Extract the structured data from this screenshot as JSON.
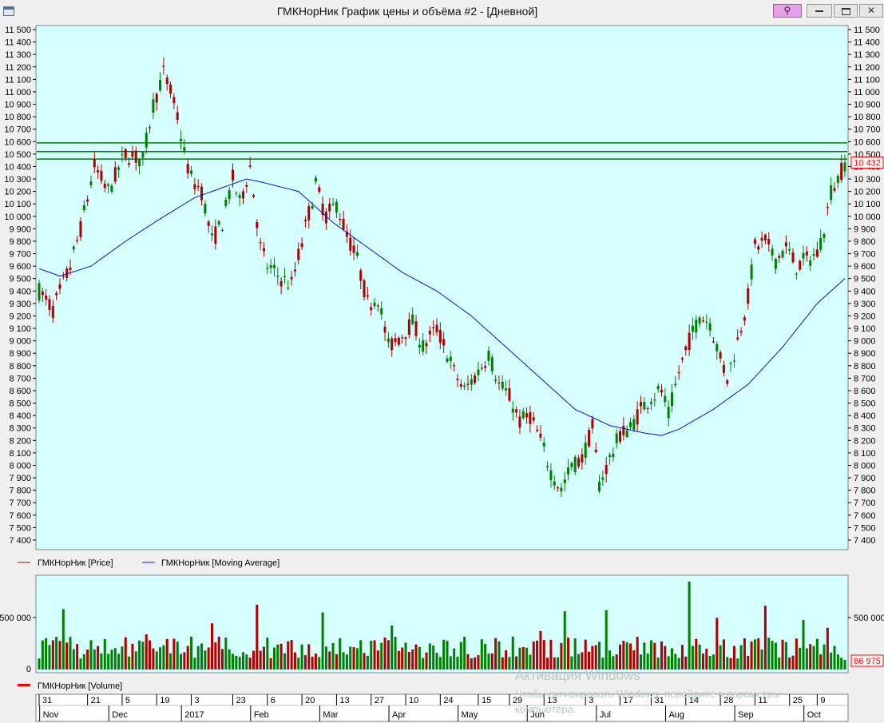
{
  "window": {
    "title": "ГМКНорНик График цены и объёма #2 - [Дневной]",
    "icons": [
      "window-icon",
      "pin-icon",
      "minimize-icon",
      "restore-icon",
      "close-icon"
    ]
  },
  "watermark": {
    "title": "Активация Windows",
    "line1": "Чтобы активировать Windows, перейдите в параметры",
    "line2": "компьютера."
  },
  "colors": {
    "panel_background": "#d6ffff",
    "up_candle": "#008000",
    "down_candle": "#b00000",
    "moving_average": "#1010c8",
    "resistance_lines": "#008000",
    "last_price": "#ff0000"
  },
  "chart_data": [
    {
      "type": "candlestick",
      "ylim": [
        7400,
        11500
      ],
      "y_ticks": [
        7400,
        7500,
        7600,
        7700,
        7800,
        7900,
        8000,
        8100,
        8200,
        8300,
        8400,
        8500,
        8600,
        8700,
        8800,
        8900,
        9000,
        9100,
        9200,
        9300,
        9400,
        9500,
        9600,
        9700,
        9800,
        9900,
        10000,
        10100,
        10200,
        10300,
        10400,
        10500,
        10600,
        10700,
        10800,
        10900,
        11000,
        11100,
        11200,
        11300,
        11400,
        11500
      ],
      "y_tick_labels": [
        "7 400",
        "7 500",
        "7 600",
        "7 700",
        "7 800",
        "7 900",
        "8 000",
        "8 100",
        "8 200",
        "8 300",
        "8 400",
        "8 500",
        "8 600",
        "8 700",
        "8 800",
        "8 900",
        "9 000",
        "9 100",
        "9 200",
        "9 300",
        "9 400",
        "9 500",
        "9 600",
        "9 700",
        "9 800",
        "9 900",
        "10 000",
        "10 100",
        "10 200",
        "10 300",
        "10 400",
        "10 500",
        "10 600",
        "10 700",
        "10 800",
        "10 900",
        "11 000",
        "11 100",
        "11 200",
        "11 300",
        "11 400",
        "11 500"
      ],
      "horizontal_levels": [
        10460,
        10520,
        10590
      ],
      "last_price": 10432,
      "last_price_label": "10 432",
      "price_path": [
        [
          0,
          9400
        ],
        [
          4,
          9250
        ],
        [
          9,
          9600
        ],
        [
          12,
          9900
        ],
        [
          16,
          10400
        ],
        [
          20,
          10200
        ],
        [
          25,
          10500
        ],
        [
          30,
          10450
        ],
        [
          33,
          10900
        ],
        [
          36,
          11150
        ],
        [
          38,
          11000
        ],
        [
          40,
          10800
        ],
        [
          42,
          10500
        ],
        [
          44,
          10300
        ],
        [
          47,
          10200
        ],
        [
          50,
          9800
        ],
        [
          53,
          9950
        ],
        [
          56,
          10300
        ],
        [
          58,
          10100
        ],
        [
          61,
          10400
        ],
        [
          64,
          9750
        ],
        [
          66,
          9600
        ],
        [
          70,
          9500
        ],
        [
          73,
          9450
        ],
        [
          76,
          9800
        ],
        [
          80,
          10250
        ],
        [
          83,
          10000
        ],
        [
          86,
          10100
        ],
        [
          89,
          9850
        ],
        [
          92,
          9650
        ],
        [
          95,
          9300
        ],
        [
          98,
          9350
        ],
        [
          101,
          8950
        ],
        [
          105,
          9050
        ],
        [
          108,
          9150
        ],
        [
          111,
          8950
        ],
        [
          115,
          9100
        ],
        [
          118,
          8900
        ],
        [
          120,
          8750
        ],
        [
          123,
          8600
        ],
        [
          127,
          8750
        ],
        [
          130,
          8900
        ],
        [
          133,
          8650
        ],
        [
          136,
          8550
        ],
        [
          139,
          8350
        ],
        [
          142,
          8400
        ],
        [
          145,
          8200
        ],
        [
          148,
          7950
        ],
        [
          151,
          7800
        ],
        [
          154,
          8000
        ],
        [
          157,
          8050
        ],
        [
          160,
          8300
        ],
        [
          162,
          7850
        ],
        [
          165,
          8050
        ],
        [
          168,
          8250
        ],
        [
          171,
          8300
        ],
        [
          174,
          8450
        ],
        [
          177,
          8550
        ],
        [
          180,
          8600
        ],
        [
          182,
          8400
        ],
        [
          185,
          8750
        ],
        [
          188,
          9000
        ],
        [
          191,
          9200
        ],
        [
          194,
          9150
        ],
        [
          197,
          8850
        ],
        [
          199,
          8700
        ],
        [
          202,
          9000
        ],
        [
          205,
          9350
        ],
        [
          207,
          9750
        ],
        [
          210,
          9800
        ],
        [
          213,
          9650
        ],
        [
          216,
          9750
        ],
        [
          219,
          9600
        ],
        [
          222,
          9650
        ],
        [
          225,
          9700
        ],
        [
          227,
          9900
        ],
        [
          229,
          10200
        ],
        [
          231,
          10300
        ],
        [
          233,
          10432
        ]
      ],
      "ma_path": [
        [
          0,
          9580
        ],
        [
          6,
          9520
        ],
        [
          15,
          9600
        ],
        [
          25,
          9800
        ],
        [
          35,
          9980
        ],
        [
          45,
          10150
        ],
        [
          55,
          10250
        ],
        [
          60,
          10300
        ],
        [
          65,
          10270
        ],
        [
          75,
          10200
        ],
        [
          85,
          9950
        ],
        [
          95,
          9750
        ],
        [
          105,
          9550
        ],
        [
          115,
          9400
        ],
        [
          125,
          9200
        ],
        [
          135,
          8950
        ],
        [
          145,
          8700
        ],
        [
          155,
          8450
        ],
        [
          165,
          8320
        ],
        [
          175,
          8260
        ],
        [
          180,
          8240
        ],
        [
          185,
          8290
        ],
        [
          195,
          8450
        ],
        [
          205,
          8650
        ],
        [
          215,
          8950
        ],
        [
          225,
          9300
        ],
        [
          233,
          9500
        ]
      ]
    },
    {
      "type": "bar",
      "series": [
        {
          "name": "ГМКНорНик [Volume]"
        }
      ],
      "y_tick_label": "500 000",
      "last_volume_label": "86 975",
      "volume_max": 800000,
      "spikes": [
        [
          7,
          550000
        ],
        [
          31,
          320000
        ],
        [
          50,
          420000
        ],
        [
          63,
          590000
        ],
        [
          82,
          520000
        ],
        [
          102,
          400000
        ],
        [
          145,
          350000
        ],
        [
          152,
          530000
        ],
        [
          164,
          540000
        ],
        [
          188,
          800000
        ],
        [
          196,
          470000
        ],
        [
          210,
          580000
        ],
        [
          221,
          450000
        ],
        [
          228,
          380000
        ]
      ]
    }
  ],
  "legend": {
    "price": "ГМКНорНик [Price]",
    "moving_average": "ГМКНорНик [Moving Average]",
    "volume": "ГМКНорНик [Volume]"
  },
  "x_axis": {
    "day_labels": [
      {
        "i": 0,
        "t": "31"
      },
      {
        "i": 14,
        "t": "21"
      },
      {
        "i": 24,
        "t": "5"
      },
      {
        "i": 34,
        "t": "19"
      },
      {
        "i": 44,
        "t": "3"
      },
      {
        "i": 56,
        "t": "23"
      },
      {
        "i": 66,
        "t": "6"
      },
      {
        "i": 76,
        "t": "20"
      },
      {
        "i": 86,
        "t": "13"
      },
      {
        "i": 96,
        "t": "27"
      },
      {
        "i": 106,
        "t": "10"
      },
      {
        "i": 116,
        "t": "24"
      },
      {
        "i": 127,
        "t": "15"
      },
      {
        "i": 136,
        "t": "29"
      },
      {
        "i": 146,
        "t": "13"
      },
      {
        "i": 158,
        "t": "3"
      },
      {
        "i": 168,
        "t": "17"
      },
      {
        "i": 177,
        "t": "31"
      },
      {
        "i": 187,
        "t": "14"
      },
      {
        "i": 197,
        "t": "28"
      },
      {
        "i": 207,
        "t": "11"
      },
      {
        "i": 217,
        "t": "25"
      },
      {
        "i": 225,
        "t": "9"
      }
    ],
    "month_labels": [
      {
        "i": 2,
        "t": "Nov"
      },
      {
        "i": 22,
        "t": "Dec"
      },
      {
        "i": 43,
        "t": "2017"
      },
      {
        "i": 63,
        "t": "Feb"
      },
      {
        "i": 83,
        "t": "Mar"
      },
      {
        "i": 103,
        "t": "Apr"
      },
      {
        "i": 123,
        "t": "May"
      },
      {
        "i": 143,
        "t": "Jun"
      },
      {
        "i": 163,
        "t": "Jul"
      },
      {
        "i": 183,
        "t": "Aug"
      },
      {
        "i": 203,
        "t": "Sep"
      },
      {
        "i": 223,
        "t": "Oct"
      }
    ]
  }
}
